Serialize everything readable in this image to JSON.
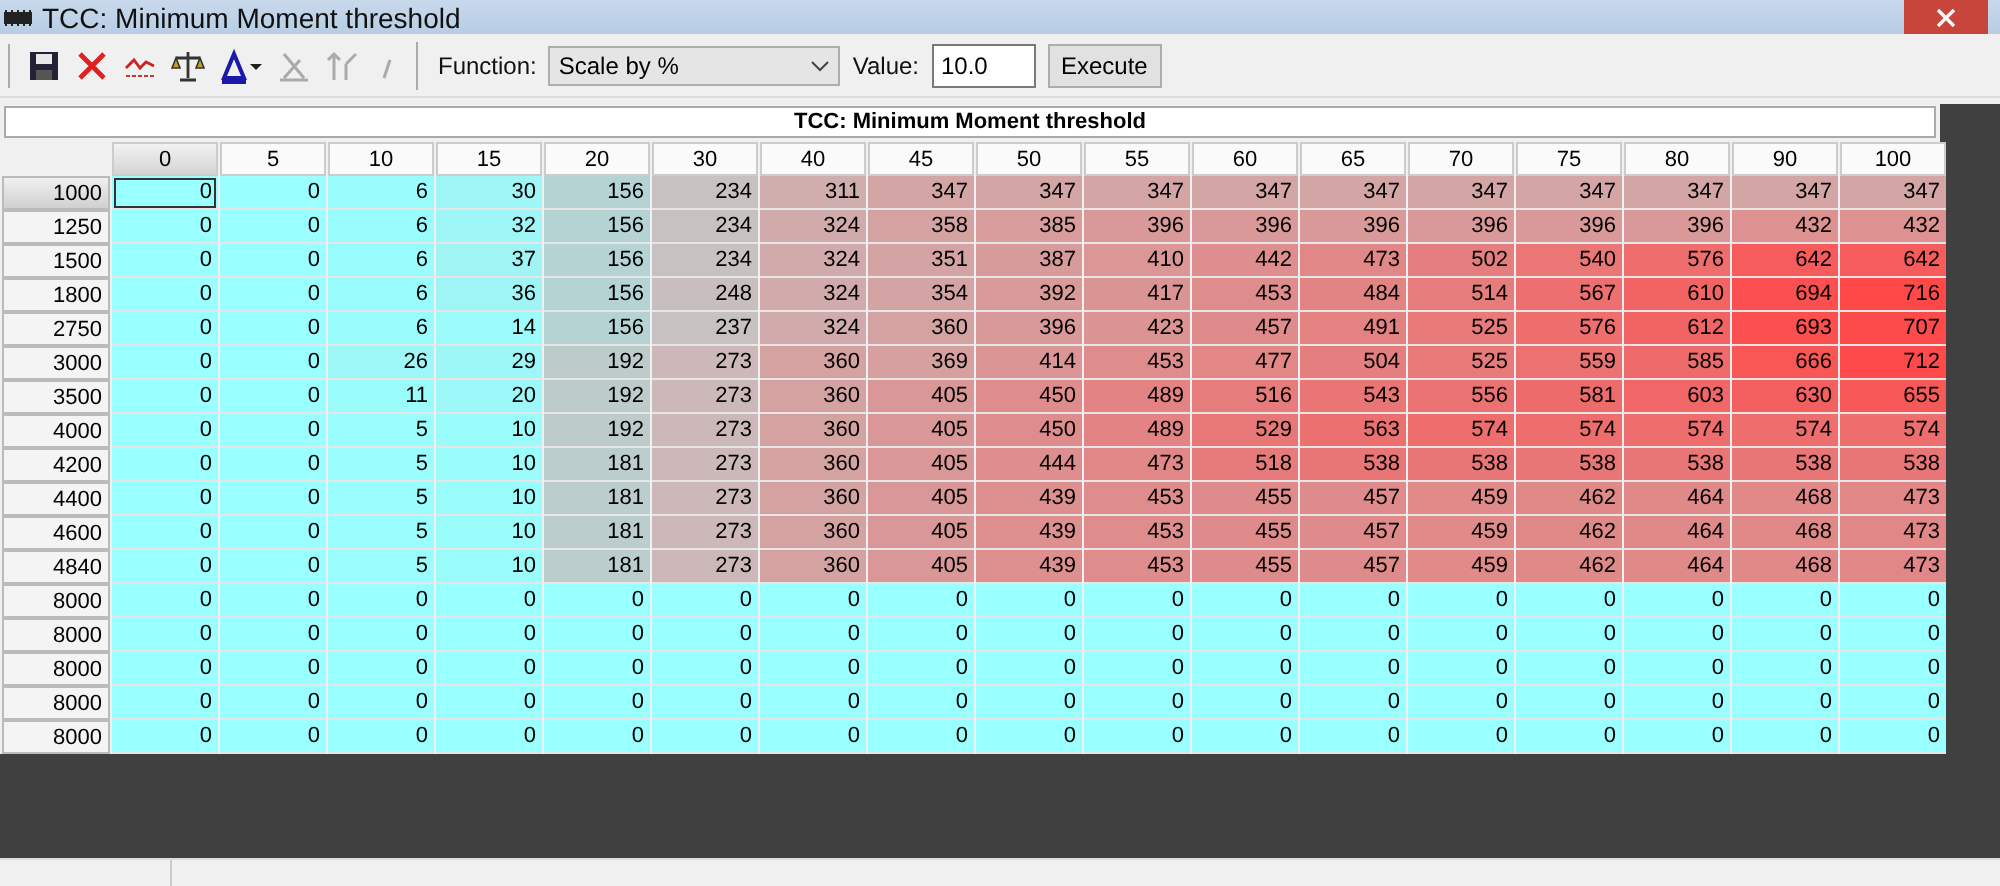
{
  "window": {
    "title": "TCC: Minimum Moment threshold"
  },
  "toolbar": {
    "function_label": "Function:",
    "function_value": "Scale by %",
    "value_label": "Value:",
    "value": "10.0",
    "execute": "Execute"
  },
  "table": {
    "title": "TCC: Minimum Moment threshold",
    "columns": [
      {
        "label": "0",
        "selected": true
      },
      {
        "label": "5",
        "selected": false
      },
      {
        "label": "10",
        "selected": false
      },
      {
        "label": "15",
        "selected": false
      },
      {
        "label": "20",
        "selected": false
      },
      {
        "label": "30",
        "selected": false
      },
      {
        "label": "40",
        "selected": false
      },
      {
        "label": "45",
        "selected": false
      },
      {
        "label": "50",
        "selected": false
      },
      {
        "label": "55",
        "selected": false
      },
      {
        "label": "60",
        "selected": false
      },
      {
        "label": "65",
        "selected": false
      },
      {
        "label": "70",
        "selected": false
      },
      {
        "label": "75",
        "selected": false
      },
      {
        "label": "80",
        "selected": false
      },
      {
        "label": "90",
        "selected": false
      },
      {
        "label": "100",
        "selected": false
      }
    ],
    "rows": [
      {
        "label": "1000",
        "selected": true,
        "cells": [
          "0",
          "0",
          "6",
          "30",
          "156",
          "234",
          "311",
          "347",
          "347",
          "347",
          "347",
          "347",
          "347",
          "347",
          "347",
          "347",
          "347"
        ]
      },
      {
        "label": "1250",
        "selected": false,
        "cells": [
          "0",
          "0",
          "6",
          "32",
          "156",
          "234",
          "324",
          "358",
          "385",
          "396",
          "396",
          "396",
          "396",
          "396",
          "396",
          "432",
          "432"
        ]
      },
      {
        "label": "1500",
        "selected": false,
        "cells": [
          "0",
          "0",
          "6",
          "37",
          "156",
          "234",
          "324",
          "351",
          "387",
          "410",
          "442",
          "473",
          "502",
          "540",
          "576",
          "642",
          "642"
        ]
      },
      {
        "label": "1800",
        "selected": false,
        "cells": [
          "0",
          "0",
          "6",
          "36",
          "156",
          "248",
          "324",
          "354",
          "392",
          "417",
          "453",
          "484",
          "514",
          "567",
          "610",
          "694",
          "716"
        ]
      },
      {
        "label": "2750",
        "selected": false,
        "cells": [
          "0",
          "0",
          "6",
          "14",
          "156",
          "237",
          "324",
          "360",
          "396",
          "423",
          "457",
          "491",
          "525",
          "576",
          "612",
          "693",
          "707"
        ]
      },
      {
        "label": "3000",
        "selected": false,
        "cells": [
          "0",
          "0",
          "26",
          "29",
          "192",
          "273",
          "360",
          "369",
          "414",
          "453",
          "477",
          "504",
          "525",
          "559",
          "585",
          "666",
          "712"
        ]
      },
      {
        "label": "3500",
        "selected": false,
        "cells": [
          "0",
          "0",
          "11",
          "20",
          "192",
          "273",
          "360",
          "405",
          "450",
          "489",
          "516",
          "543",
          "556",
          "581",
          "603",
          "630",
          "655"
        ]
      },
      {
        "label": "4000",
        "selected": false,
        "cells": [
          "0",
          "0",
          "5",
          "10",
          "192",
          "273",
          "360",
          "405",
          "450",
          "489",
          "529",
          "563",
          "574",
          "574",
          "574",
          "574",
          "574"
        ]
      },
      {
        "label": "4200",
        "selected": false,
        "cells": [
          "0",
          "0",
          "5",
          "10",
          "181",
          "273",
          "360",
          "405",
          "444",
          "473",
          "518",
          "538",
          "538",
          "538",
          "538",
          "538",
          "538"
        ]
      },
      {
        "label": "4400",
        "selected": false,
        "cells": [
          "0",
          "0",
          "5",
          "10",
          "181",
          "273",
          "360",
          "405",
          "439",
          "453",
          "455",
          "457",
          "459",
          "462",
          "464",
          "468",
          "473"
        ]
      },
      {
        "label": "4600",
        "selected": false,
        "cells": [
          "0",
          "0",
          "5",
          "10",
          "181",
          "273",
          "360",
          "405",
          "439",
          "453",
          "455",
          "457",
          "459",
          "462",
          "464",
          "468",
          "473"
        ]
      },
      {
        "label": "4840",
        "selected": false,
        "cells": [
          "0",
          "0",
          "5",
          "10",
          "181",
          "273",
          "360",
          "405",
          "439",
          "453",
          "455",
          "457",
          "459",
          "462",
          "464",
          "468",
          "473"
        ]
      },
      {
        "label": "8000",
        "selected": false,
        "cells": [
          "0",
          "0",
          "0",
          "0",
          "0",
          "0",
          "0",
          "0",
          "0",
          "0",
          "0",
          "0",
          "0",
          "0",
          "0",
          "0",
          "0"
        ]
      },
      {
        "label": "8000",
        "selected": false,
        "cells": [
          "0",
          "0",
          "0",
          "0",
          "0",
          "0",
          "0",
          "0",
          "0",
          "0",
          "0",
          "0",
          "0",
          "0",
          "0",
          "0",
          "0"
        ]
      },
      {
        "label": "8000",
        "selected": false,
        "cells": [
          "0",
          "0",
          "0",
          "0",
          "0",
          "0",
          "0",
          "0",
          "0",
          "0",
          "0",
          "0",
          "0",
          "0",
          "0",
          "0",
          "0"
        ]
      },
      {
        "label": "8000",
        "selected": false,
        "cells": [
          "0",
          "0",
          "0",
          "0",
          "0",
          "0",
          "0",
          "0",
          "0",
          "0",
          "0",
          "0",
          "0",
          "0",
          "0",
          "0",
          "0"
        ]
      },
      {
        "label": "8000",
        "selected": false,
        "cells": [
          "0",
          "0",
          "0",
          "0",
          "0",
          "0",
          "0",
          "0",
          "0",
          "0",
          "0",
          "0",
          "0",
          "0",
          "0",
          "0",
          "0"
        ]
      }
    ]
  }
}
